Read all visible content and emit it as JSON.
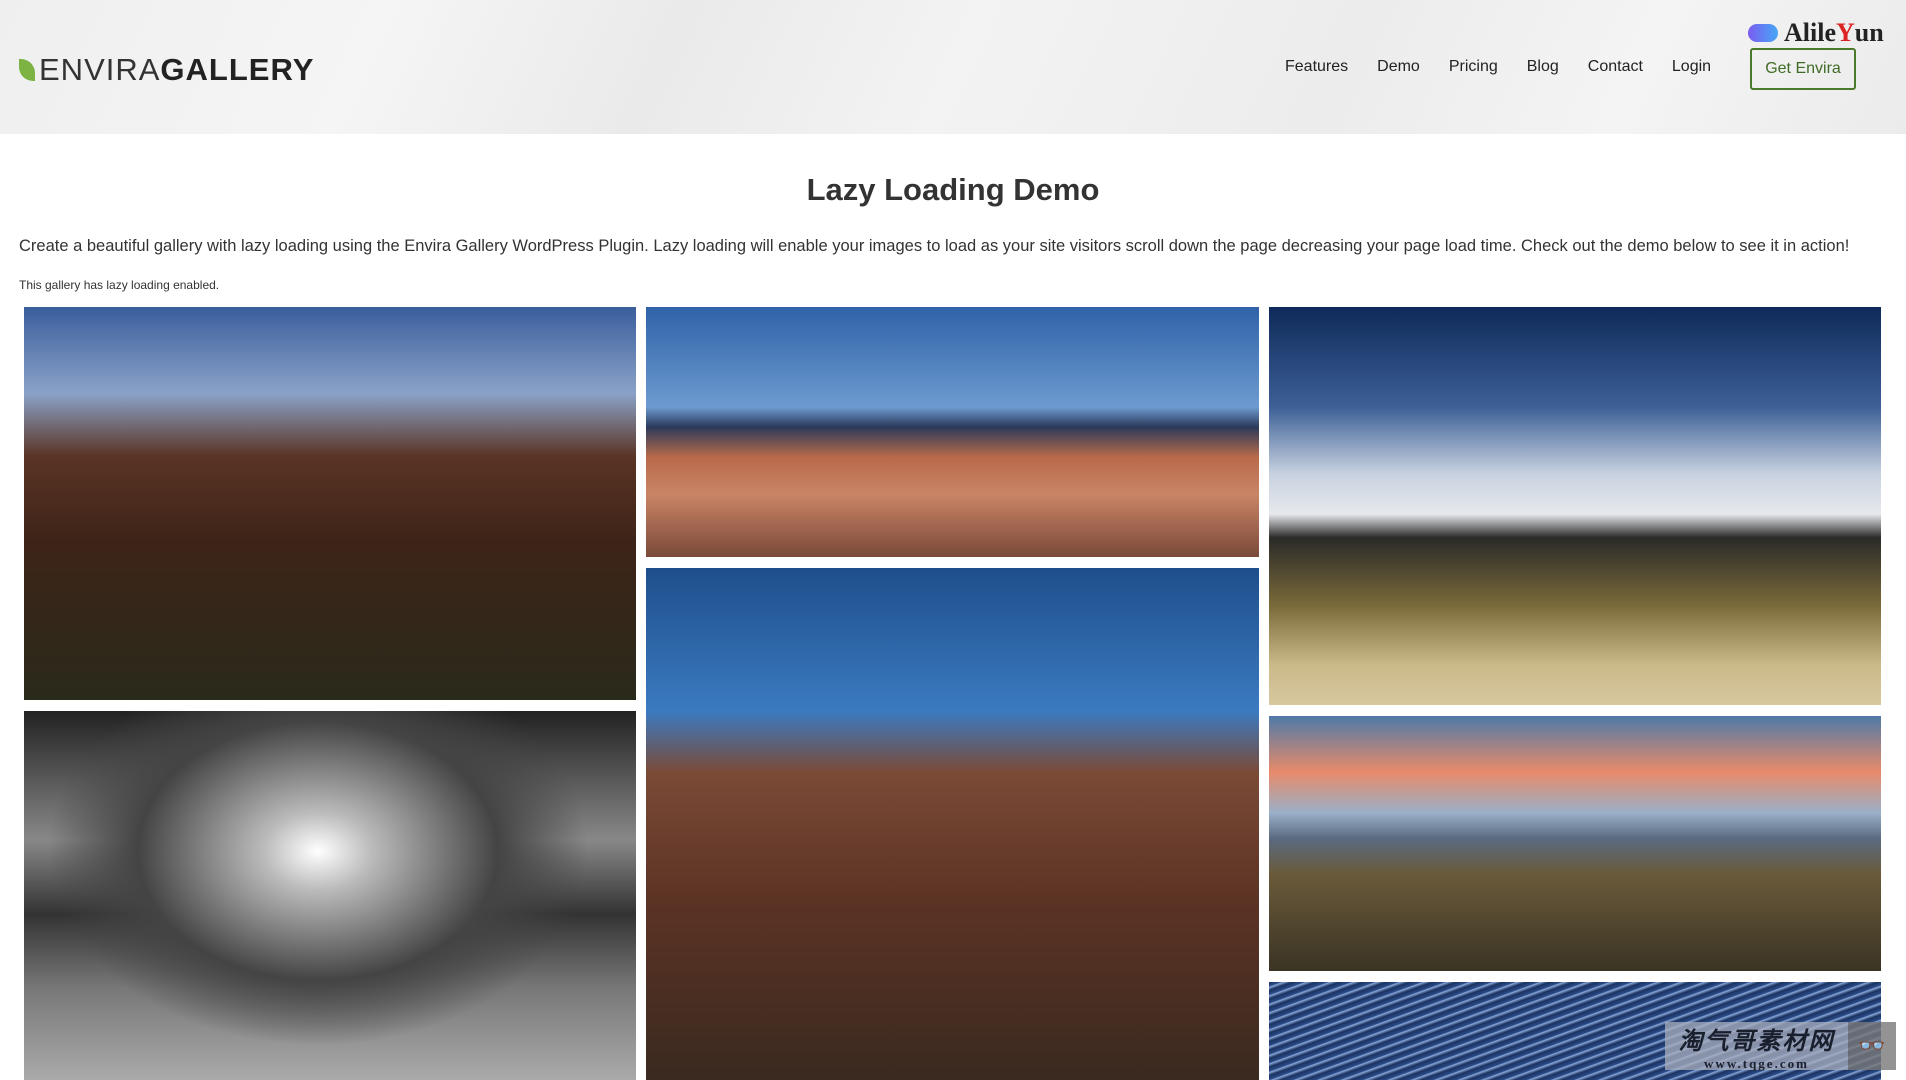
{
  "header": {
    "logo": {
      "part1": "ENVIRA",
      "part2": "GALLERY"
    },
    "nav": [
      "Features",
      "Demo",
      "Pricing",
      "Blog",
      "Contact",
      "Login"
    ],
    "cta": "Get Envira",
    "watermark_top": {
      "part1": "Alile",
      "part2": "Y",
      "part3": "un"
    }
  },
  "main": {
    "title": "Lazy Loading Demo",
    "intro": "Create a beautiful gallery with lazy loading using the Envira Gallery WordPress Plugin. Lazy loading will enable your images to load as your site visitors scroll down the page decreasing your page load time. Check out the demo below to see it in action!",
    "note": "This gallery has lazy loading enabled."
  },
  "gallery": [
    {
      "subject": "canyon-night-road"
    },
    {
      "subject": "bryce-canyon-panorama"
    },
    {
      "subject": "snowy-mountains-road"
    },
    {
      "subject": "black-white-dunes"
    },
    {
      "subject": "zion-star-trails"
    },
    {
      "subject": "sunset-badlands"
    },
    {
      "subject": "star-trails-blue"
    }
  ],
  "watermark_bottom": {
    "title": "淘气哥素材网",
    "url": "www.tqge.com"
  }
}
